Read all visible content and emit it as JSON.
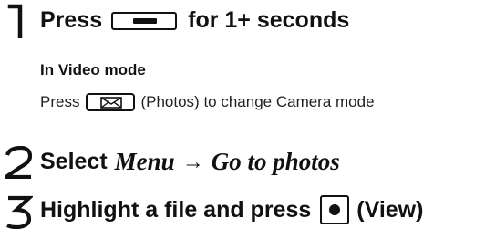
{
  "steps": [
    {
      "number": "1",
      "text_before": "Press",
      "key_icon": "wide-key-icon",
      "text_after": "for 1+ seconds",
      "sub_heading": "In Video mode",
      "sub_before": "Press",
      "sub_key_icon": "mail-key-icon",
      "sub_after": "(Photos) to change Camera mode"
    },
    {
      "number": "2",
      "text_before": "Select",
      "menu_label": "Menu",
      "arrow": "→",
      "menu_target": "Go to photos"
    },
    {
      "number": "3",
      "text_before": "Highlight a file and press",
      "key_icon": "center-key-icon",
      "text_after": "(View)"
    }
  ]
}
